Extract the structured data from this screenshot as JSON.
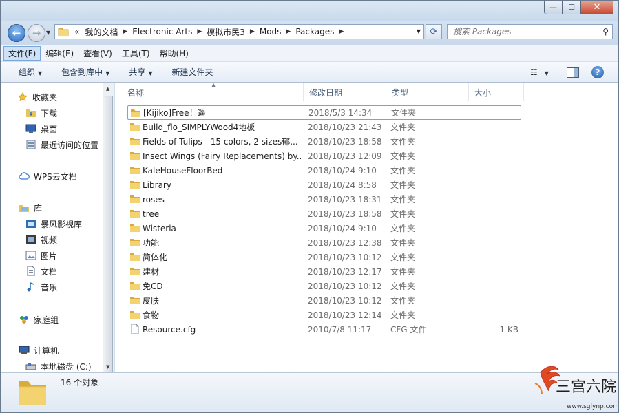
{
  "window": {
    "minimize_glyph": "—",
    "maximize_glyph": "☐",
    "close_glyph": "✕"
  },
  "breadcrumb": [
    "我的文档",
    "Electronic Arts",
    "模拟市民3",
    "Mods",
    "Packages"
  ],
  "breadcrumb_prefix": "«",
  "search": {
    "placeholder": "搜索 Packages"
  },
  "menu": [
    "文件(F)",
    "编辑(E)",
    "查看(V)",
    "工具(T)",
    "帮助(H)"
  ],
  "toolbar": {
    "organize": "组织",
    "include_library": "包含到库中",
    "share": "共享",
    "new_folder": "新建文件夹"
  },
  "nav": {
    "favorites": "收藏夹",
    "downloads": "下载",
    "desktop": "桌面",
    "recent": "最近访问的位置",
    "wps_cloud": "WPS云文档",
    "libraries": "库",
    "baofeng": "暴风影视库",
    "videos": "视频",
    "pictures": "图片",
    "documents": "文档",
    "music": "音乐",
    "homegroup": "家庭组",
    "computer": "计算机",
    "local_disk": "本地磁盘 (C:)"
  },
  "columns": {
    "name": "名称",
    "date": "修改日期",
    "type": "类型",
    "size": "大小"
  },
  "files": [
    {
      "name": "[Kijiko]Free！遥",
      "date": "2018/5/3 14:34",
      "type": "文件夹",
      "size": "",
      "kind": "folder"
    },
    {
      "name": "Build_flo_SIMPLYWood4地板",
      "date": "2018/10/23 21:43",
      "type": "文件夹",
      "size": "",
      "kind": "folder"
    },
    {
      "name": "Fields of Tulips - 15 colors, 2 sizes郁...",
      "date": "2018/10/23 18:58",
      "type": "文件夹",
      "size": "",
      "kind": "folder"
    },
    {
      "name": "Insect Wings (Fairy Replacements) by...",
      "date": "2018/10/23 12:09",
      "type": "文件夹",
      "size": "",
      "kind": "folder"
    },
    {
      "name": "KaleHouseFloorBed",
      "date": "2018/10/24 9:10",
      "type": "文件夹",
      "size": "",
      "kind": "folder"
    },
    {
      "name": "Library",
      "date": "2018/10/24 8:58",
      "type": "文件夹",
      "size": "",
      "kind": "folder"
    },
    {
      "name": "roses",
      "date": "2018/10/23 18:31",
      "type": "文件夹",
      "size": "",
      "kind": "folder"
    },
    {
      "name": "tree",
      "date": "2018/10/23 18:58",
      "type": "文件夹",
      "size": "",
      "kind": "folder"
    },
    {
      "name": "Wisteria",
      "date": "2018/10/24 9:10",
      "type": "文件夹",
      "size": "",
      "kind": "folder"
    },
    {
      "name": "功能",
      "date": "2018/10/23 12:38",
      "type": "文件夹",
      "size": "",
      "kind": "folder"
    },
    {
      "name": "简体化",
      "date": "2018/10/23 10:12",
      "type": "文件夹",
      "size": "",
      "kind": "folder"
    },
    {
      "name": "建材",
      "date": "2018/10/23 12:17",
      "type": "文件夹",
      "size": "",
      "kind": "folder"
    },
    {
      "name": "免CD",
      "date": "2018/10/23 10:12",
      "type": "文件夹",
      "size": "",
      "kind": "folder"
    },
    {
      "name": "皮肤",
      "date": "2018/10/23 10:12",
      "type": "文件夹",
      "size": "",
      "kind": "folder"
    },
    {
      "name": "食物",
      "date": "2018/10/23 12:14",
      "type": "文件夹",
      "size": "",
      "kind": "folder"
    },
    {
      "name": "Resource.cfg",
      "date": "2010/7/8 11:17",
      "type": "CFG 文件",
      "size": "1 KB",
      "kind": "file"
    }
  ],
  "status": {
    "count_text": "16 个对象"
  },
  "watermark": {
    "text": "三宫六院",
    "url": "www.sglynp.com"
  }
}
